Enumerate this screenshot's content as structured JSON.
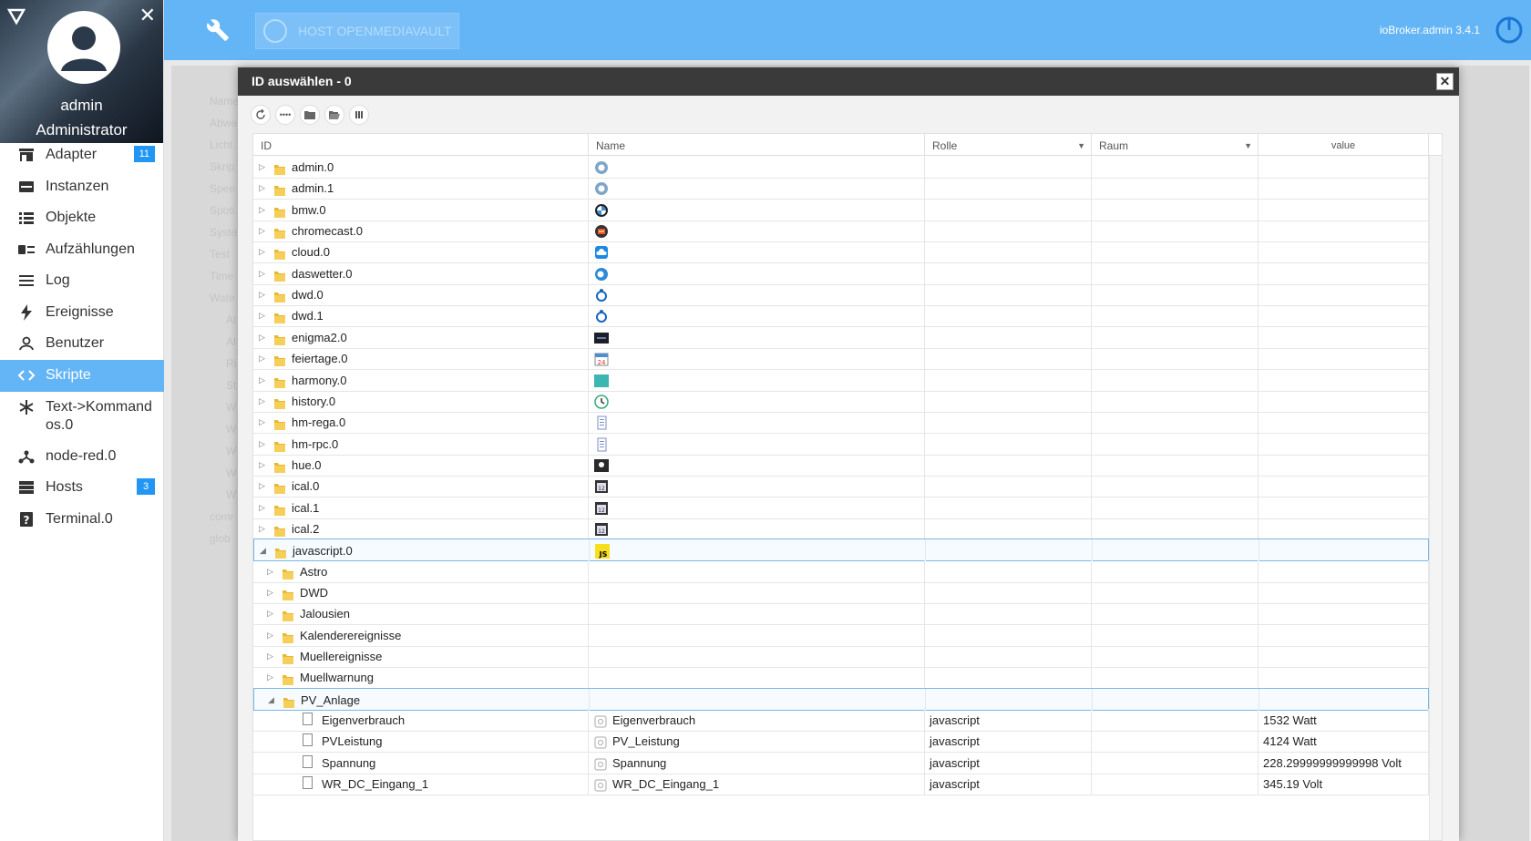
{
  "sidebar": {
    "user": "admin",
    "role": "Administrator",
    "items": [
      {
        "label": "Adapter",
        "icon": "store-icon",
        "badge": "11"
      },
      {
        "label": "Instanzen",
        "icon": "instances-icon",
        "badge": ""
      },
      {
        "label": "Objekte",
        "icon": "list-icon",
        "badge": ""
      },
      {
        "label": "Aufzählungen",
        "icon": "enum-icon",
        "badge": ""
      },
      {
        "label": "Log",
        "icon": "log-icon",
        "badge": ""
      },
      {
        "label": "Ereignisse",
        "icon": "lightning-icon",
        "badge": ""
      },
      {
        "label": "Benutzer",
        "icon": "user-icon",
        "badge": ""
      },
      {
        "label": "Skripte",
        "icon": "code-icon",
        "badge": ""
      },
      {
        "label": "Text->Kommandos.0",
        "icon": "snowflake-icon",
        "badge": ""
      },
      {
        "label": "node-red.0",
        "icon": "node-red-icon",
        "badge": ""
      },
      {
        "label": "Hosts",
        "icon": "hosts-icon",
        "badge": "3"
      },
      {
        "label": "Terminal.0",
        "icon": "terminal-icon",
        "badge": ""
      }
    ]
  },
  "topbar": {
    "host_label": "HOST OPENMEDIAVAULT",
    "version": "ioBroker.admin 3.4.1"
  },
  "background": {
    "ghost_labels": [
      "Name",
      "Abwe",
      "Licht",
      "Skrip",
      "Spee",
      "Spoti",
      "Syste",
      "Test",
      "Time",
      "Wate",
      "Al",
      "Al",
      "Ri",
      "St",
      "W",
      "W",
      "W",
      "W",
      "W",
      "comr",
      "glob",
      "Sichern falls"
    ]
  },
  "dialog": {
    "title": "ID auswählen - 0",
    "columns": {
      "id": "ID",
      "name": "Name",
      "rolle": "Rolle",
      "raum": "Raum",
      "value": "value"
    },
    "rows": [
      {
        "id": "admin.0",
        "level": 0,
        "type": "folder",
        "expanded": false,
        "icon": "admin-icon",
        "name": "",
        "rolle": "",
        "raum": "",
        "value": ""
      },
      {
        "id": "admin.1",
        "level": 0,
        "type": "folder",
        "expanded": false,
        "icon": "admin-icon",
        "name": "",
        "rolle": "",
        "raum": "",
        "value": ""
      },
      {
        "id": "bmw.0",
        "level": 0,
        "type": "folder",
        "expanded": false,
        "icon": "bmw-icon",
        "name": "",
        "rolle": "",
        "raum": "",
        "value": ""
      },
      {
        "id": "chromecast.0",
        "level": 0,
        "type": "folder",
        "expanded": false,
        "icon": "chromecast-icon",
        "name": "",
        "rolle": "",
        "raum": "",
        "value": ""
      },
      {
        "id": "cloud.0",
        "level": 0,
        "type": "folder",
        "expanded": false,
        "icon": "cloud-icon",
        "name": "",
        "rolle": "",
        "raum": "",
        "value": ""
      },
      {
        "id": "daswetter.0",
        "level": 0,
        "type": "folder",
        "expanded": false,
        "icon": "weather-icon",
        "name": "",
        "rolle": "",
        "raum": "",
        "value": ""
      },
      {
        "id": "dwd.0",
        "level": 0,
        "type": "folder",
        "expanded": false,
        "icon": "dwd-icon",
        "name": "",
        "rolle": "",
        "raum": "",
        "value": ""
      },
      {
        "id": "dwd.1",
        "level": 0,
        "type": "folder",
        "expanded": false,
        "icon": "dwd-icon",
        "name": "",
        "rolle": "",
        "raum": "",
        "value": ""
      },
      {
        "id": "enigma2.0",
        "level": 0,
        "type": "folder",
        "expanded": false,
        "icon": "enigma2-icon",
        "name": "",
        "rolle": "",
        "raum": "",
        "value": ""
      },
      {
        "id": "feiertage.0",
        "level": 0,
        "type": "folder",
        "expanded": false,
        "icon": "calendar-icon",
        "name": "",
        "rolle": "",
        "raum": "",
        "value": ""
      },
      {
        "id": "harmony.0",
        "level": 0,
        "type": "folder",
        "expanded": false,
        "icon": "harmony-icon",
        "name": "",
        "rolle": "",
        "raum": "",
        "value": ""
      },
      {
        "id": "history.0",
        "level": 0,
        "type": "folder",
        "expanded": false,
        "icon": "history-icon",
        "name": "",
        "rolle": "",
        "raum": "",
        "value": ""
      },
      {
        "id": "hm-rega.0",
        "level": 0,
        "type": "folder",
        "expanded": false,
        "icon": "homematic-icon",
        "name": "",
        "rolle": "",
        "raum": "",
        "value": ""
      },
      {
        "id": "hm-rpc.0",
        "level": 0,
        "type": "folder",
        "expanded": false,
        "icon": "homematic-icon",
        "name": "",
        "rolle": "",
        "raum": "",
        "value": ""
      },
      {
        "id": "hue.0",
        "level": 0,
        "type": "folder",
        "expanded": false,
        "icon": "hue-icon",
        "name": "",
        "rolle": "",
        "raum": "",
        "value": ""
      },
      {
        "id": "ical.0",
        "level": 0,
        "type": "folder",
        "expanded": false,
        "icon": "ical-icon",
        "name": "",
        "rolle": "",
        "raum": "",
        "value": ""
      },
      {
        "id": "ical.1",
        "level": 0,
        "type": "folder",
        "expanded": false,
        "icon": "ical-icon",
        "name": "",
        "rolle": "",
        "raum": "",
        "value": ""
      },
      {
        "id": "ical.2",
        "level": 0,
        "type": "folder",
        "expanded": false,
        "icon": "ical-icon",
        "name": "",
        "rolle": "",
        "raum": "",
        "value": ""
      },
      {
        "id": "javascript.0",
        "level": 0,
        "type": "folder",
        "expanded": true,
        "selected": true,
        "icon": "javascript-icon",
        "name": "",
        "rolle": "",
        "raum": "",
        "value": ""
      },
      {
        "id": "Astro",
        "level": 1,
        "type": "folder",
        "expanded": false,
        "icon": "",
        "name": "",
        "rolle": "",
        "raum": "",
        "value": ""
      },
      {
        "id": "DWD",
        "level": 1,
        "type": "folder",
        "expanded": false,
        "icon": "",
        "name": "",
        "rolle": "",
        "raum": "",
        "value": ""
      },
      {
        "id": "Jalousien",
        "level": 1,
        "type": "folder",
        "expanded": false,
        "icon": "",
        "name": "",
        "rolle": "",
        "raum": "",
        "value": ""
      },
      {
        "id": "Kalenderereignisse",
        "level": 1,
        "type": "folder",
        "expanded": false,
        "icon": "",
        "name": "",
        "rolle": "",
        "raum": "",
        "value": ""
      },
      {
        "id": "Muellereignisse",
        "level": 1,
        "type": "folder",
        "expanded": false,
        "icon": "",
        "name": "",
        "rolle": "",
        "raum": "",
        "value": ""
      },
      {
        "id": "Muellwarnung",
        "level": 1,
        "type": "folder",
        "expanded": false,
        "icon": "",
        "name": "",
        "rolle": "",
        "raum": "",
        "value": ""
      },
      {
        "id": "PV_Anlage",
        "level": 1,
        "type": "folder",
        "expanded": true,
        "selected": true,
        "icon": "",
        "name": "",
        "rolle": "",
        "raum": "",
        "value": ""
      },
      {
        "id": "Eigenverbrauch",
        "level": 2,
        "type": "state",
        "icon": "state-icon",
        "name": "Eigenverbrauch",
        "rolle": "javascript",
        "raum": "",
        "value": "1532 Watt"
      },
      {
        "id": "PVLeistung",
        "level": 2,
        "type": "state",
        "icon": "state-icon",
        "name": "PV_Leistung",
        "rolle": "javascript",
        "raum": "",
        "value": "4124 Watt"
      },
      {
        "id": "Spannung",
        "level": 2,
        "type": "state",
        "icon": "state-icon",
        "name": "Spannung",
        "rolle": "javascript",
        "raum": "",
        "value": "228.29999999999998 Volt"
      },
      {
        "id": "WR_DC_Eingang_1",
        "level": 2,
        "type": "state",
        "icon": "state-icon",
        "name": "WR_DC_Eingang_1",
        "rolle": "javascript",
        "raum": "",
        "value": "345.19 Volt"
      }
    ]
  },
  "colors": {
    "topbar": "#64b5f6",
    "active_nav": "#64b5f6",
    "badge": "#2196f3",
    "dialog_title": "#3a3a3a",
    "folder": "#f2c94c"
  }
}
